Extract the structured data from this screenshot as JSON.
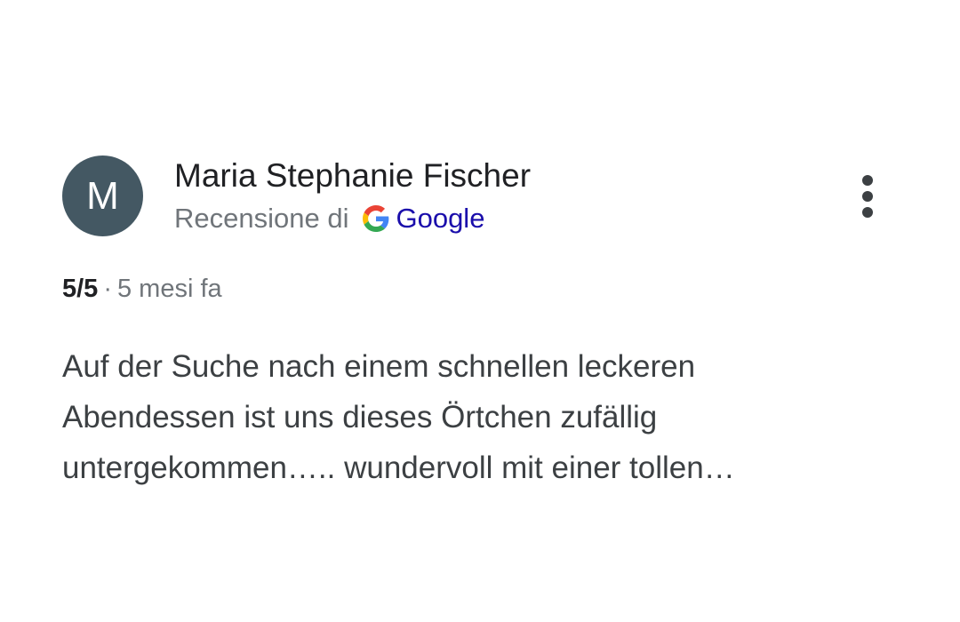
{
  "review": {
    "avatar_initial": "M",
    "author_name": "Maria Stephanie Fischer",
    "source_prefix": "Recensione di",
    "source_name": "Google",
    "rating": "5/5",
    "separator": "·",
    "time_ago": "5 mesi fa",
    "text_lines": [
      "Auf der Suche nach einem schnellen leckeren",
      "Abendessen ist uns dieses Örtchen zufällig",
      "untergekommen….. wundervoll mit einer tollen…"
    ]
  },
  "icons": {
    "source_logo": "google-g-icon",
    "more": "more-vert-icon"
  },
  "colors": {
    "avatar_bg": "#445863",
    "google_link": "#1a0dab",
    "google_blue": "#4285F4",
    "google_red": "#EA4335",
    "google_yellow": "#FBBC05",
    "google_green": "#34A853"
  }
}
